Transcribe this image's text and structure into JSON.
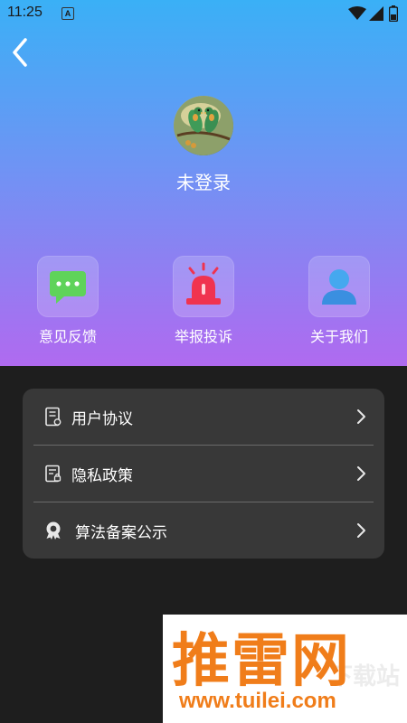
{
  "status_bar": {
    "time": "11:25",
    "notification_glyph": "A"
  },
  "header": {
    "username": "未登录"
  },
  "quick_actions": [
    {
      "label": "意见反馈",
      "icon": "chat-bubble-icon"
    },
    {
      "label": "举报投诉",
      "icon": "alarm-light-icon"
    },
    {
      "label": "关于我们",
      "icon": "person-icon"
    }
  ],
  "menu": [
    {
      "label": "用户协议",
      "icon": "document-icon"
    },
    {
      "label": "隐私政策",
      "icon": "privacy-document-icon"
    },
    {
      "label": "算法备案公示",
      "icon": "badge-icon"
    }
  ],
  "watermark": {
    "logo": "推雷网",
    "url": "www.tuilei.com",
    "sub": "下载站"
  },
  "colors": {
    "gradient_top": "#3ab0f6",
    "gradient_bottom": "#b06af0",
    "background": "#1e1e1e",
    "card": "#383838",
    "watermark": "#f07d1a"
  }
}
